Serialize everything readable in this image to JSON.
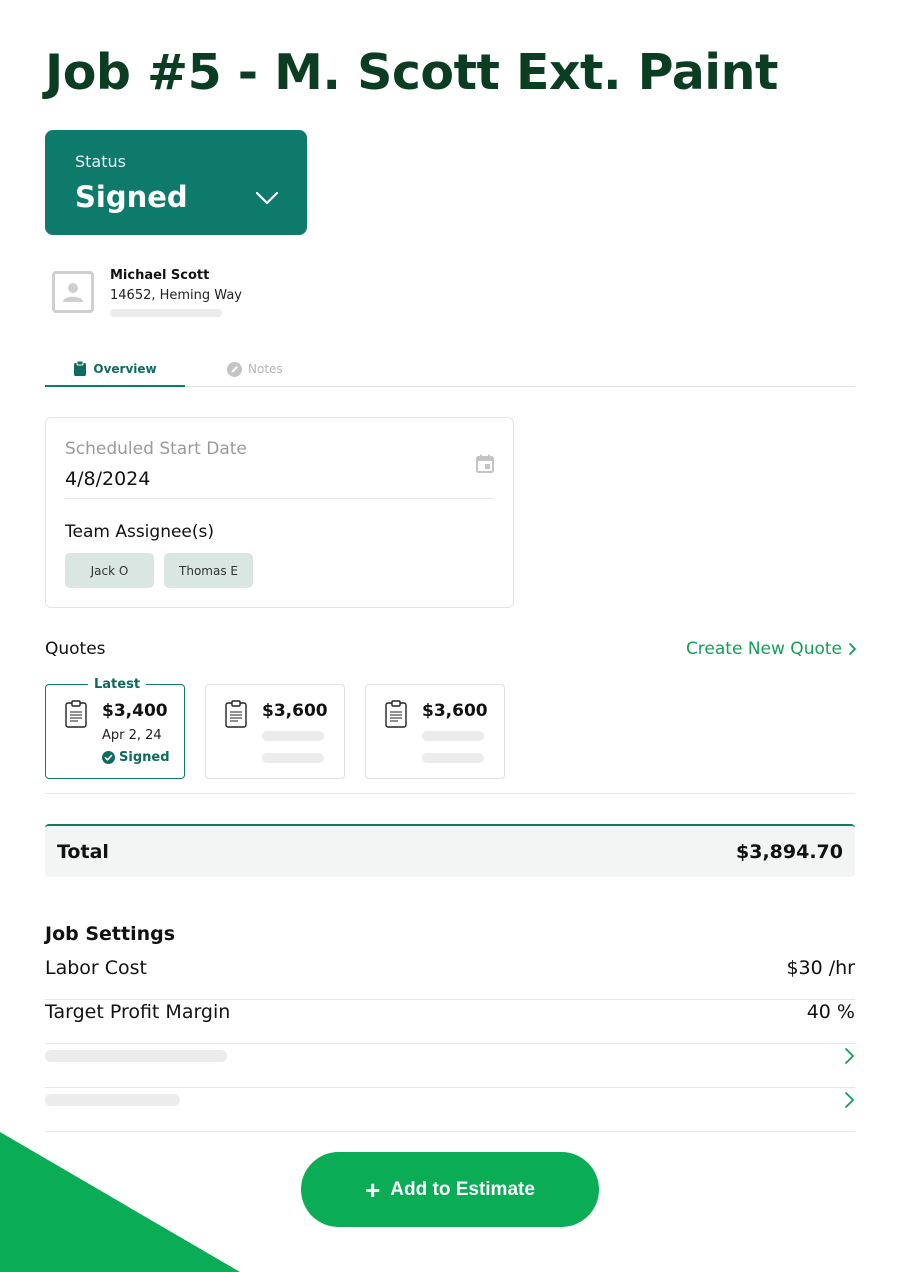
{
  "page": {
    "title": "Job #5 - M. Scott Ext. Paint"
  },
  "status": {
    "label": "Status",
    "value": "Signed",
    "bg_color": "#0e7a6b"
  },
  "customer": {
    "name": "Michael Scott",
    "address": "14652, Heming Way"
  },
  "tabs": [
    {
      "label": "Overview",
      "icon": "clipboard-icon",
      "active": true
    },
    {
      "label": "Notes",
      "icon": "pencil-icon",
      "active": false
    }
  ],
  "schedule": {
    "start_label": "Scheduled Start Date",
    "start_value": "4/8/2024",
    "team_label": "Team Assignee(s)",
    "assignees": [
      "Jack O",
      "Thomas E"
    ]
  },
  "quotes": {
    "label": "Quotes",
    "create_label": "Create New Quote",
    "items": [
      {
        "tag": "Latest",
        "amount": "$3,400",
        "date": "Apr 2, 24",
        "status": "Signed"
      },
      {
        "amount": "$3,600"
      },
      {
        "amount": "$3,600"
      }
    ]
  },
  "total": {
    "label": "Total",
    "value": "$3,894.70"
  },
  "job_settings": {
    "title": "Job Settings",
    "rows": [
      {
        "label": "Labor Cost",
        "value": "$30 /hr"
      },
      {
        "label": "Target Profit Margin",
        "value": "40 %"
      }
    ]
  },
  "actions": {
    "add_label": "Add to Estimate"
  },
  "colors": {
    "primary": "#0e7a6b",
    "accent_green": "#0aac56",
    "title": "#0b3d22"
  }
}
